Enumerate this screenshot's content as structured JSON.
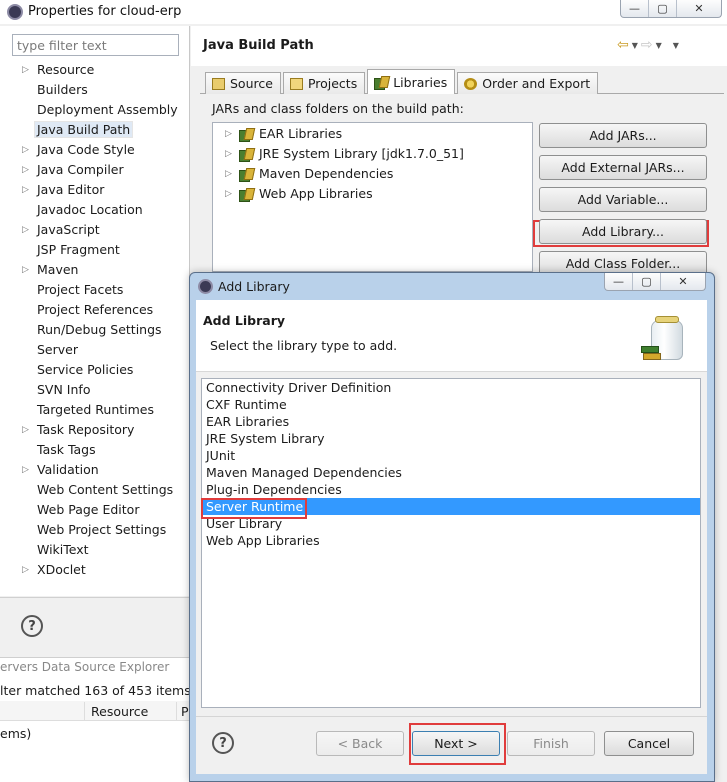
{
  "main_window": {
    "title": "Properties for cloud-erp",
    "filter_placeholder": "type filter text",
    "page_title": "Java Build Path",
    "nav_items": [
      {
        "label": "Resource",
        "expandable": true
      },
      {
        "label": "Builders",
        "expandable": false
      },
      {
        "label": "Deployment Assembly",
        "expandable": false
      },
      {
        "label": "Java Build Path",
        "expandable": false,
        "selected": true
      },
      {
        "label": "Java Code Style",
        "expandable": true
      },
      {
        "label": "Java Compiler",
        "expandable": true
      },
      {
        "label": "Java Editor",
        "expandable": true
      },
      {
        "label": "Javadoc Location",
        "expandable": false
      },
      {
        "label": "JavaScript",
        "expandable": true
      },
      {
        "label": "JSP Fragment",
        "expandable": false
      },
      {
        "label": "Maven",
        "expandable": true
      },
      {
        "label": "Project Facets",
        "expandable": false
      },
      {
        "label": "Project References",
        "expandable": false
      },
      {
        "label": "Run/Debug Settings",
        "expandable": false
      },
      {
        "label": "Server",
        "expandable": false
      },
      {
        "label": "Service Policies",
        "expandable": false
      },
      {
        "label": "SVN Info",
        "expandable": false
      },
      {
        "label": "Targeted Runtimes",
        "expandable": false
      },
      {
        "label": "Task Repository",
        "expandable": true
      },
      {
        "label": "Task Tags",
        "expandable": false
      },
      {
        "label": "Validation",
        "expandable": true
      },
      {
        "label": "Web Content Settings",
        "expandable": false
      },
      {
        "label": "Web Page Editor",
        "expandable": false
      },
      {
        "label": "Web Project Settings",
        "expandable": false
      },
      {
        "label": "WikiText",
        "expandable": false
      },
      {
        "label": "XDoclet",
        "expandable": true
      }
    ],
    "tabs": [
      {
        "label": "Source",
        "active": false
      },
      {
        "label": "Projects",
        "active": false
      },
      {
        "label": "Libraries",
        "active": true
      },
      {
        "label": "Order and Export",
        "active": false
      }
    ],
    "jars_label": "JARs and class folders on the build path:",
    "tree_items": [
      "EAR Libraries",
      "JRE System Library [jdk1.7.0_51]",
      "Maven Dependencies",
      "Web App Libraries"
    ],
    "buttons": {
      "add_jars": "Add JARs...",
      "add_external_jars": "Add External JARs...",
      "add_variable": "Add Variable...",
      "add_library": "Add Library...",
      "add_class_folder": "Add Class Folder..."
    },
    "help_glyph": "?"
  },
  "background_view": {
    "tabs_text": "ervers   Data Source Explorer",
    "filter_text": "lter matched 163 of 453 items)",
    "columns": [
      "Resource",
      "P"
    ],
    "row_text": "ems)"
  },
  "dialog": {
    "title": "Add Library",
    "heading": "Add Library",
    "description": "Select the library type to add.",
    "library_types": [
      "Connectivity Driver Definition",
      "CXF Runtime",
      "EAR Libraries",
      "JRE System Library",
      "JUnit",
      "Maven Managed Dependencies",
      "Plug-in Dependencies",
      "Server Runtime",
      "User Library",
      "Web App Libraries"
    ],
    "selected_library": "Server Runtime",
    "buttons": {
      "back": "< Back",
      "next": "Next >",
      "finish": "Finish",
      "cancel": "Cancel"
    },
    "help_glyph": "?"
  },
  "colors": {
    "selection": "#3399ff",
    "highlight_box": "#e03c3c",
    "dialog_frame": "#b9d1ea"
  }
}
